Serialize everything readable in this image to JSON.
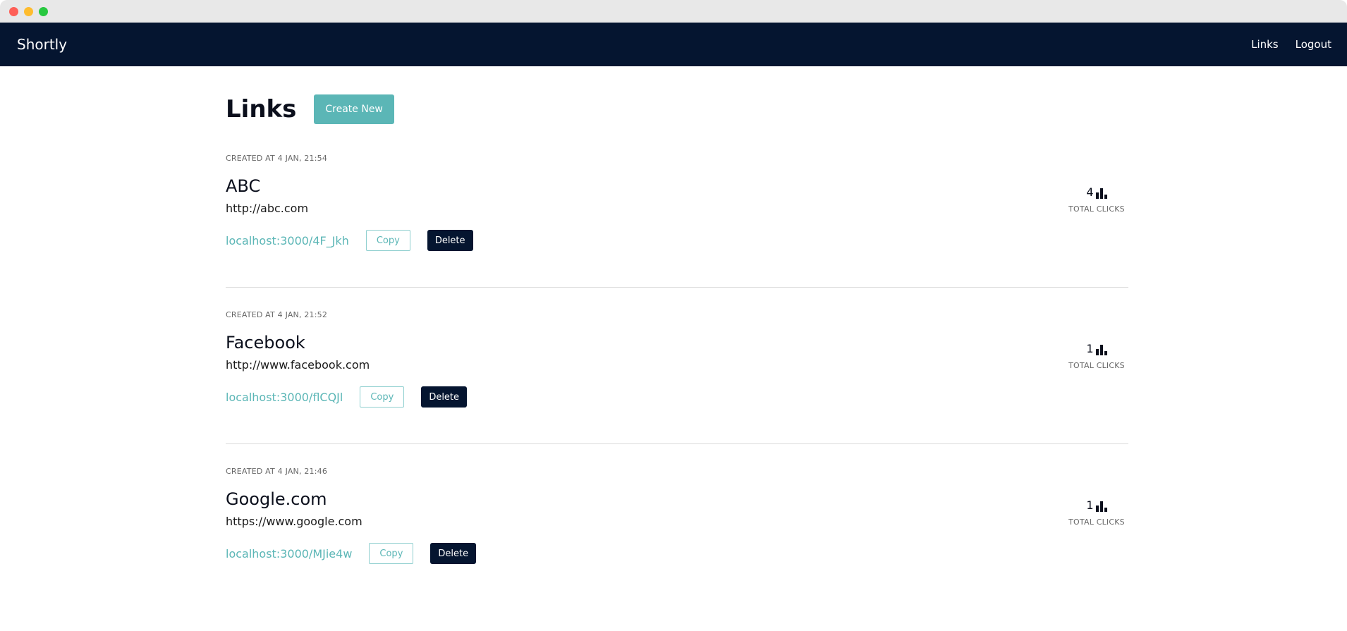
{
  "app": {
    "brand": "Shortly"
  },
  "nav": {
    "links_label": "Links",
    "logout_label": "Logout"
  },
  "colors": {
    "navbar": "#051530",
    "accent": "#5bb6b6",
    "traffic_red": "#fe5f57",
    "traffic_yellow": "#febc2e",
    "traffic_green": "#28c840"
  },
  "page": {
    "title": "Links",
    "create_label": "Create New"
  },
  "links": [
    {
      "created": "CREATED AT 4 JAN, 21:54",
      "title": "ABC",
      "url": "http://abc.com",
      "short": "localhost:3000/4F_Jkh",
      "copy_label": "Copy",
      "delete_label": "Delete",
      "clicks": "4",
      "clicks_label": "TOTAL CLICKS"
    },
    {
      "created": "CREATED AT 4 JAN, 21:52",
      "title": "Facebook",
      "url": "http://www.facebook.com",
      "short": "localhost:3000/flCQJl",
      "copy_label": "Copy",
      "delete_label": "Delete",
      "clicks": "1",
      "clicks_label": "TOTAL CLICKS"
    },
    {
      "created": "CREATED AT 4 JAN, 21:46",
      "title": "Google.com",
      "url": "https://www.google.com",
      "short": "localhost:3000/MJie4w",
      "copy_label": "Copy",
      "delete_label": "Delete",
      "clicks": "1",
      "clicks_label": "TOTAL CLICKS"
    }
  ],
  "icons": {
    "clicks": "bar-chart-icon"
  }
}
